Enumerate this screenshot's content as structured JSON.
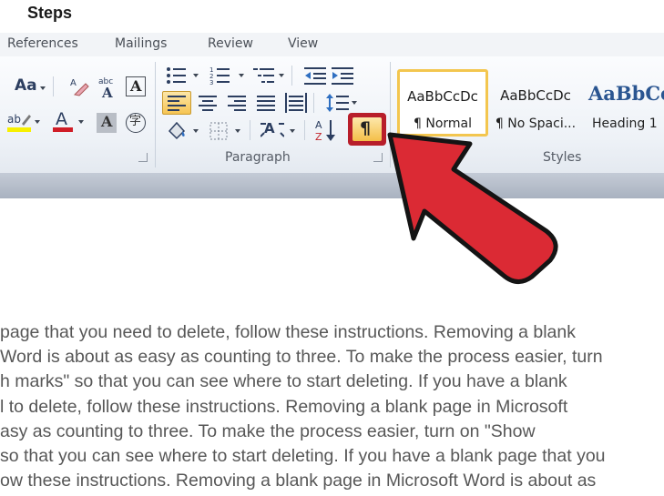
{
  "header": {
    "title": "Steps"
  },
  "ribbon": {
    "tabs": [
      "References",
      "Mailings",
      "Review",
      "View"
    ],
    "groups": {
      "paragraph": "Paragraph",
      "styles": "Styles"
    },
    "font_buttons": {
      "change_case": "Aa",
      "text_effects": "A",
      "char_shading": "A",
      "enclose": "字",
      "abc": "abc"
    },
    "sort_label": "A↓Z",
    "show_marks_glyph": "¶",
    "styles": [
      {
        "sample": "AaBbCcDc",
        "name": "¶ Normal"
      },
      {
        "sample": "AaBbCcDc",
        "name": "¶ No Spaci..."
      },
      {
        "sample": "AaBbCc",
        "name": "Heading 1"
      }
    ]
  },
  "document": {
    "lines": [
      "page that you need to delete, follow these instructions. Removing a blank",
      "Word is about as easy as counting to three. To make the process easier, turn",
      "h marks\" so that you can see where to start deleting. If you have a blank",
      "l to delete, follow these instructions. Removing a blank page in Microsoft",
      "asy as counting to three. To make the process easier, turn on \"Show",
      "so that you can see where to start deleting. If you have a blank page that you",
      "ow these instructions. Removing a blank page in Microsoft Word is about as"
    ]
  },
  "colors": {
    "arrow": "#d9232d",
    "highlight": "#f2c04a",
    "selected_style_border": "#f3c64f"
  }
}
